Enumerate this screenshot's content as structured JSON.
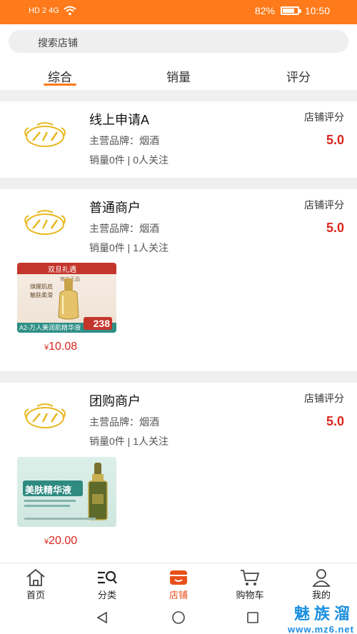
{
  "status_bar": {
    "left_indicators": "HD 2 4G",
    "battery": "82%",
    "battery_level": 0.82,
    "time": "10:50"
  },
  "search": {
    "placeholder": "搜索店铺"
  },
  "tabs": [
    {
      "label": "综合",
      "active": true
    },
    {
      "label": "销量",
      "active": false
    },
    {
      "label": "评分",
      "active": false
    }
  ],
  "stores": [
    {
      "name": "线上申请A",
      "brand": "主营品牌：烟酒",
      "stats": "销量0件 | 0人关注",
      "rating_label": "店铺评分",
      "rating": "5.0"
    },
    {
      "name": "普通商户",
      "brand": "主营品牌：烟酒",
      "stats": "销量0件 | 1人关注",
      "rating_label": "店铺评分",
      "rating": "5.0",
      "product": {
        "banner": "双旦礼遇",
        "sub": "官方正品",
        "lines": [
          "焕醒肌底",
          "触肤柔滑"
        ],
        "caption": "A2-万人美润肌精华液",
        "price_tag": "238",
        "price_symbol": "¥",
        "price": "10.08"
      }
    },
    {
      "name": "团购商户",
      "brand": "主营品牌：烟酒",
      "stats": "销量0件 | 1人关注",
      "rating_label": "店铺评分",
      "rating": "5.0",
      "product": {
        "headline": "美肤精华液",
        "price_symbol": "¥",
        "price": "20.00"
      }
    }
  ],
  "tabbar": [
    {
      "label": "首页",
      "icon": "home-icon"
    },
    {
      "label": "分类",
      "icon": "category-search-icon"
    },
    {
      "label": "店铺",
      "icon": "store-icon",
      "active": true
    },
    {
      "label": "购物车",
      "icon": "cart-icon"
    },
    {
      "label": "我的",
      "icon": "user-icon"
    }
  ],
  "watermark": {
    "title": "魅族溜",
    "url": "www.mz6.net"
  },
  "colors": {
    "accent": "#ff7a1a",
    "price": "#d9261c",
    "watermark": "#1a8fe0"
  }
}
